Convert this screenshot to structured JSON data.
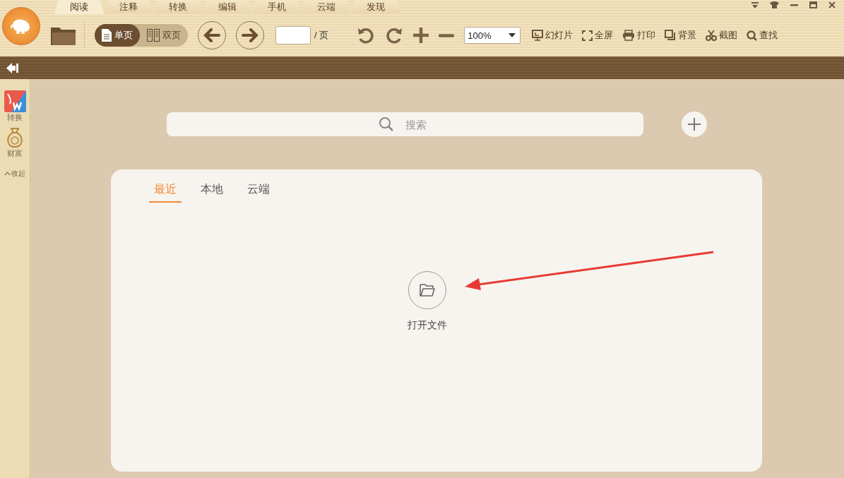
{
  "menu_tabs": [
    {
      "label": "阅读",
      "selected": true
    },
    {
      "label": "注释",
      "selected": false
    },
    {
      "label": "转换",
      "selected": false
    },
    {
      "label": "编辑",
      "selected": false
    },
    {
      "label": "手机",
      "selected": false
    },
    {
      "label": "云端",
      "selected": false
    },
    {
      "label": "发现",
      "selected": false
    }
  ],
  "view_modes": [
    {
      "label": "单页",
      "kind": "single",
      "selected": true
    },
    {
      "label": "双页",
      "kind": "double",
      "selected": false
    }
  ],
  "page_suffix": "/ 页",
  "zoom": {
    "value": "100%"
  },
  "tool_buttons": [
    {
      "label": "幻灯片",
      "kind": "slideshow"
    },
    {
      "label": "全屏",
      "kind": "fullscreen"
    },
    {
      "label": "打印",
      "kind": "print"
    },
    {
      "label": "背景",
      "kind": "background"
    },
    {
      "label": "截图",
      "kind": "screenshot"
    },
    {
      "label": "查找",
      "kind": "search"
    }
  ],
  "sidebar": {
    "items": [
      {
        "label": "转换",
        "kind": "convert"
      },
      {
        "label": "财富",
        "kind": "wealth"
      }
    ],
    "collapse": "收起"
  },
  "search": {
    "placeholder": "搜索"
  },
  "library_tabs": [
    {
      "label": "最近",
      "selected": true
    },
    {
      "label": "本地",
      "selected": false
    },
    {
      "label": "云端",
      "selected": false
    }
  ],
  "open_file": {
    "label": "打开文件"
  }
}
